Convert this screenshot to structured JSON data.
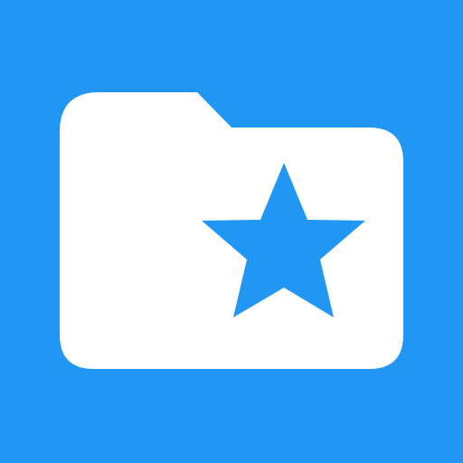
{
  "icon": {
    "name": "starred-folder-icon",
    "background_color": "#2196F3",
    "folder_color": "#FFFFFF",
    "star_color": "#2196F3"
  }
}
